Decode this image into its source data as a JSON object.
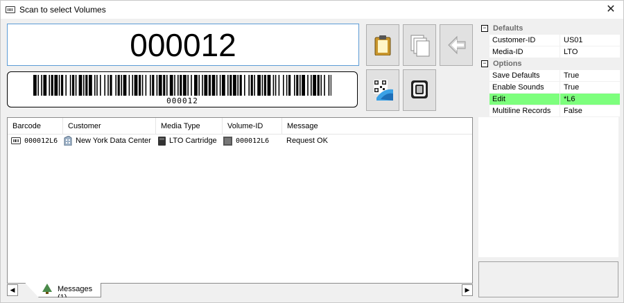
{
  "window": {
    "title": "Scan to select Volumes",
    "close_label": "✕"
  },
  "scan": {
    "value": "000012",
    "barcode_text": "000012"
  },
  "toolbar": {
    "paste_icon": "clipboard-paste-icon",
    "copy_icon": "copy-pages-icon",
    "back_icon": "back-arrow-icon",
    "qr_icon": "qr-code-scan-icon",
    "chip_icon": "rfid-chip-icon"
  },
  "list": {
    "columns": [
      "Barcode",
      "Customer",
      "Media Type",
      "Volume-ID",
      "Message"
    ],
    "rows": [
      {
        "barcode": "000012L6",
        "customer": "New York Data Center",
        "media_type": "LTO Cartridge",
        "volume_id": "000012L6",
        "message": "Request OK"
      }
    ]
  },
  "tabs": {
    "messages_label": "Messages (1)",
    "scroll_left": "◀",
    "scroll_right": "▶"
  },
  "properties": {
    "defaults": {
      "label": "Defaults",
      "toggle": "−",
      "items": [
        {
          "key": "Customer-ID",
          "value": "US01"
        },
        {
          "key": "Media-ID",
          "value": "LTO"
        }
      ]
    },
    "options": {
      "label": "Options",
      "toggle": "−",
      "items": [
        {
          "key": "Save Defaults",
          "value": "True"
        },
        {
          "key": "Enable Sounds",
          "value": "True"
        },
        {
          "key": "Edit",
          "value": "*L6"
        },
        {
          "key": "Multiline Records",
          "value": "False"
        }
      ]
    }
  },
  "colors": {
    "accent_border": "#5b9bd5",
    "selected_row": "#7dff7d"
  }
}
